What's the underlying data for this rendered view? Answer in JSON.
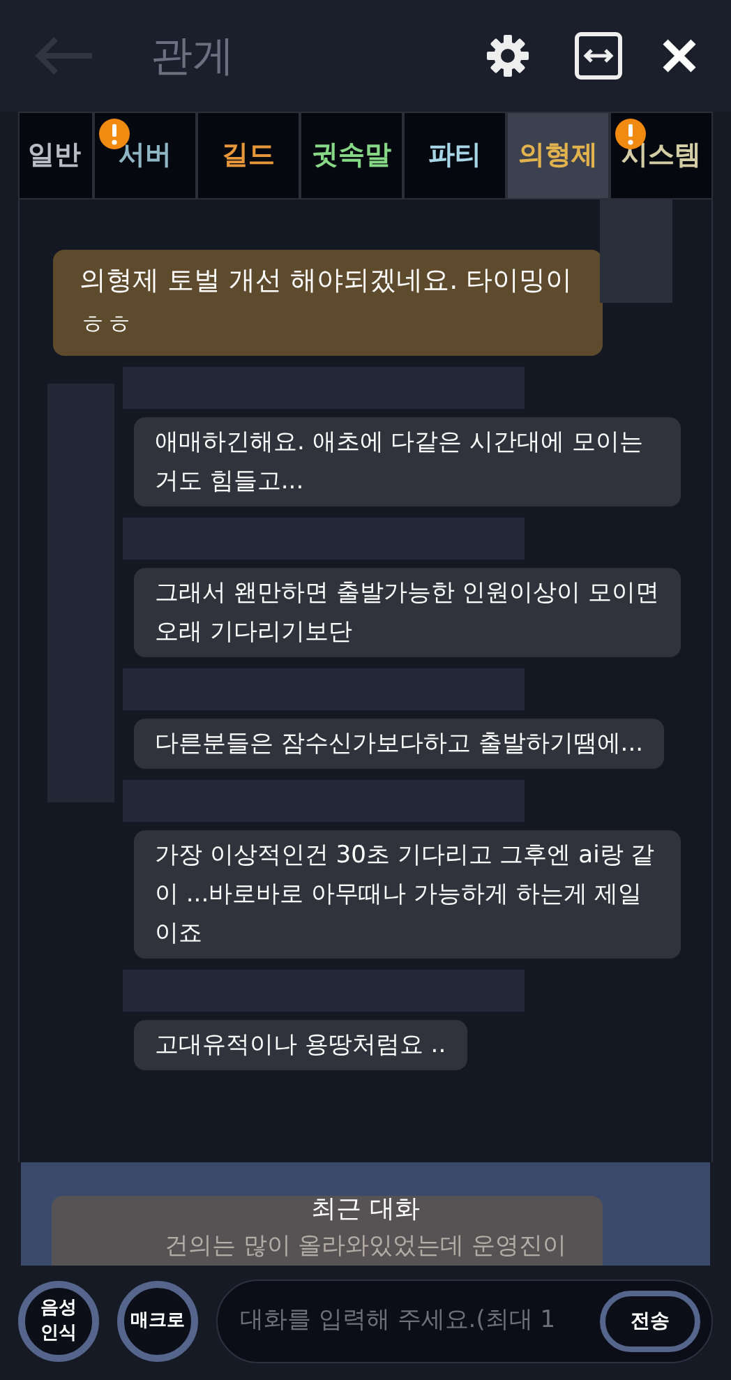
{
  "header": {
    "title": "관게"
  },
  "tabs": [
    {
      "label": "일반",
      "selected": false,
      "alert": false,
      "kind": "general"
    },
    {
      "label": "서버",
      "selected": false,
      "alert": true,
      "kind": "server"
    },
    {
      "label": "길드",
      "selected": false,
      "alert": false,
      "kind": "guild"
    },
    {
      "label": "귓속말",
      "selected": false,
      "alert": false,
      "kind": "whisper"
    },
    {
      "label": "파티",
      "selected": false,
      "alert": false,
      "kind": "party"
    },
    {
      "label": "의형제",
      "selected": true,
      "alert": false,
      "kind": "brotherhood"
    },
    {
      "label": "시스템",
      "selected": false,
      "alert": true,
      "kind": "system"
    }
  ],
  "messages": [
    {
      "kind": "own",
      "text": "의형제 토벌 개선 해야되겠네요. 타이밍이 ㅎㅎ"
    },
    {
      "kind": "other",
      "avatar": true,
      "text": "애매하긴해요. 애초에 다같은 시간대에 모이는거도 힘들고..."
    },
    {
      "kind": "other",
      "avatar": false,
      "text": "그래서 왠만하면 출발가능한 인원이상이 모이면 오래 기다리기보단"
    },
    {
      "kind": "other",
      "avatar": false,
      "text": "다른분들은 잠수신가보다하고 출발하기땜에..."
    },
    {
      "kind": "other",
      "avatar": false,
      "text": "가장 이상적인건 30초 기다리고 그후엔 ai랑 같이 ...바로바로 아무때나 가능하게 하는게 제일이죠"
    },
    {
      "kind": "other",
      "avatar": false,
      "text": "고대유적이나 용땅처럼요 .."
    }
  ],
  "recent": {
    "label": "최근 대화",
    "preview": "건의는 많이 올라와있었는데 운영진이"
  },
  "input": {
    "voice_button": "음성 인식",
    "macro_button": "매크로",
    "placeholder": "대화를 입력해 주세요.(최대 1",
    "send_button": "전송"
  }
}
